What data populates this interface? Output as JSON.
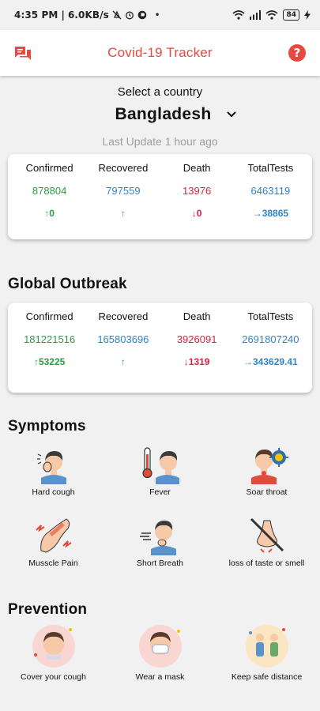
{
  "status_bar": {
    "time": "4:35 PM",
    "network_speed": "6.0KB/s",
    "battery": "84"
  },
  "app": {
    "title": "Covid-19 Tracker",
    "accent": "#e8493f"
  },
  "selector": {
    "label": "Select a country",
    "country": "Bangladesh"
  },
  "last_update": "Last Update 1 hour ago",
  "country_stats": {
    "headers": [
      "Confirmed",
      "Recovered",
      "Death",
      "TotalTests"
    ],
    "values": [
      "878804",
      "797559",
      "13976",
      "6463119"
    ],
    "changes": [
      "0",
      "",
      "0",
      "38865"
    ]
  },
  "global": {
    "title": "Global Outbreak",
    "headers": [
      "Confirmed",
      "Recovered",
      "Death",
      "TotalTests"
    ],
    "values": [
      "181221516",
      "165803696",
      "3926091",
      "2691807240"
    ],
    "changes": [
      "53225",
      "",
      "1319",
      "343629.41"
    ]
  },
  "symptoms": {
    "title": "Symptoms",
    "items": [
      {
        "label": "Hard cough",
        "icon": "cough-icon"
      },
      {
        "label": "Fever",
        "icon": "fever-icon"
      },
      {
        "label": "Soar throat",
        "icon": "sore-throat-icon"
      },
      {
        "label": "Musscle Pain",
        "icon": "muscle-pain-icon"
      },
      {
        "label": "Short Breath",
        "icon": "short-breath-icon"
      },
      {
        "label": "loss of taste or smell",
        "icon": "loss-of-smell-icon"
      }
    ]
  },
  "prevention": {
    "title": "Prevention",
    "items": [
      {
        "label": "Cover your cough",
        "icon": "cover-cough-icon"
      },
      {
        "label": "Wear a mask",
        "icon": "mask-icon"
      },
      {
        "label": "Keep safe distance",
        "icon": "distance-icon"
      }
    ]
  },
  "colors": {
    "confirmed": "#2f9a44",
    "recovered": "#2f84c9",
    "death": "#e02040",
    "tests": "#2f84c9"
  }
}
